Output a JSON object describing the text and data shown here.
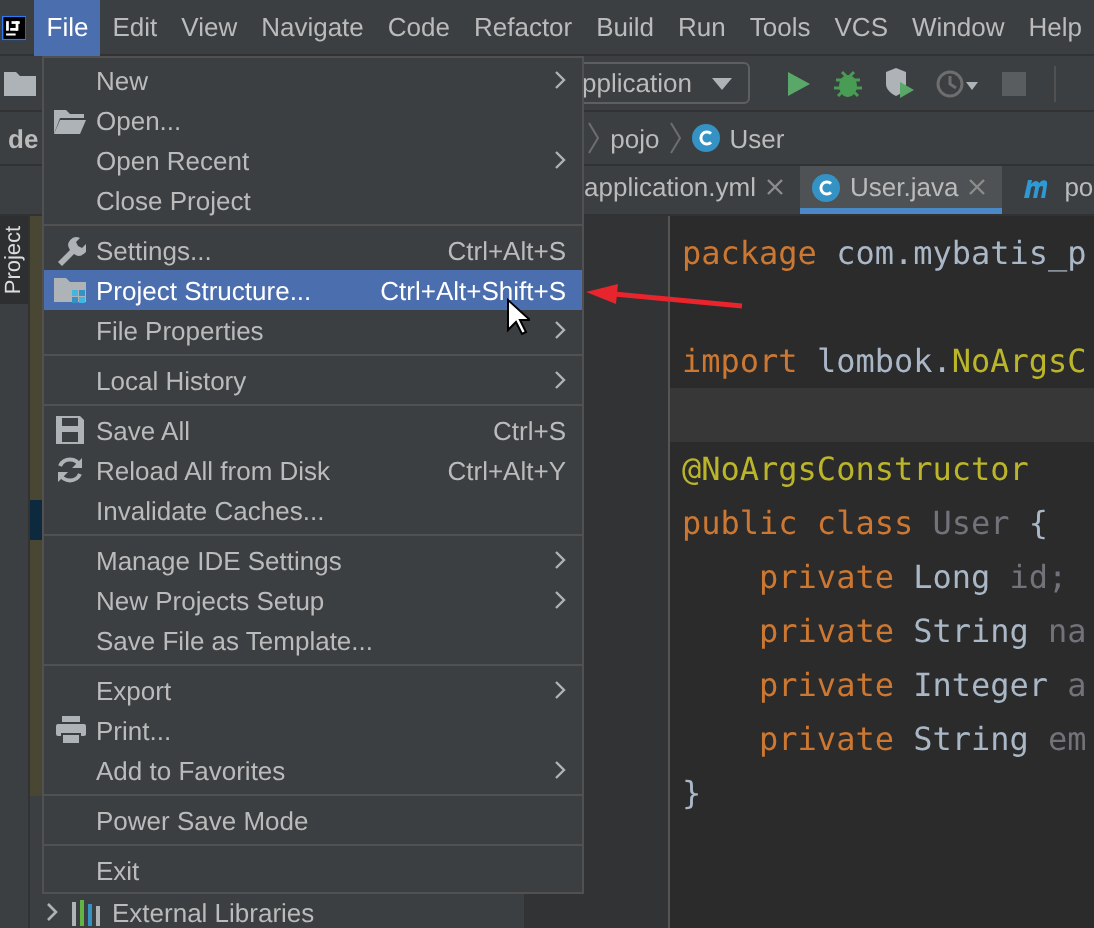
{
  "menubar": [
    {
      "label": "File",
      "selected": true
    },
    {
      "label": "Edit",
      "selected": false
    },
    {
      "label": "View",
      "selected": false
    },
    {
      "label": "Navigate",
      "selected": false
    },
    {
      "label": "Code",
      "selected": false
    },
    {
      "label": "Refactor",
      "selected": false
    },
    {
      "label": "Build",
      "selected": false
    },
    {
      "label": "Run",
      "selected": false
    },
    {
      "label": "Tools",
      "selected": false
    },
    {
      "label": "VCS",
      "selected": false
    },
    {
      "label": "Window",
      "selected": false
    },
    {
      "label": "Help",
      "selected": false
    }
  ],
  "toolbar": {
    "run_config": "pplication"
  },
  "breadcrumbs": [
    {
      "label": "de",
      "kind": "text"
    },
    {
      "label": "pojo",
      "kind": "text"
    },
    {
      "label": "User",
      "kind": "class"
    }
  ],
  "tabs": [
    {
      "label": "application.yml",
      "selected": false,
      "kind": "yaml"
    },
    {
      "label": "User.java",
      "selected": true,
      "kind": "class"
    },
    {
      "label": "po",
      "selected": false,
      "kind": "mapper"
    }
  ],
  "project_tool_tab": {
    "label": "Project",
    "selected": true
  },
  "project_tree": [
    {
      "label": "External Libraries"
    }
  ],
  "code": [
    {
      "current": false,
      "tokens": [
        {
          "kind": "kw",
          "text": "package "
        },
        {
          "kind": "plain",
          "text": "com.mybatis_p"
        }
      ]
    },
    {
      "current": false
    },
    {
      "current": false,
      "tokens": [
        {
          "kind": "kw",
          "text": "import "
        },
        {
          "kind": "plain",
          "text": "lombok."
        },
        {
          "kind": "ann",
          "text": "NoArgsC"
        }
      ]
    },
    {
      "current": true
    },
    {
      "current": false,
      "tokens": [
        {
          "kind": "ann",
          "text": "@NoArgsConstructor"
        }
      ]
    },
    {
      "current": false,
      "tokens": [
        {
          "kind": "kw",
          "text": "public class "
        },
        {
          "kind": "dim",
          "text": "User "
        },
        {
          "kind": "plain",
          "text": "{"
        }
      ]
    },
    {
      "current": false,
      "tokens": [
        {
          "kind": "kw",
          "text": "    private "
        },
        {
          "kind": "plain",
          "text": "Long "
        },
        {
          "kind": "dim",
          "text": "id;"
        }
      ]
    },
    {
      "current": false,
      "tokens": [
        {
          "kind": "kw",
          "text": "    private "
        },
        {
          "kind": "plain",
          "text": "String "
        },
        {
          "kind": "dim",
          "text": "na"
        }
      ]
    },
    {
      "current": false,
      "tokens": [
        {
          "kind": "kw",
          "text": "    private "
        },
        {
          "kind": "plain",
          "text": "Integer "
        },
        {
          "kind": "dim",
          "text": "a"
        }
      ]
    },
    {
      "current": false,
      "tokens": [
        {
          "kind": "kw",
          "text": "    private "
        },
        {
          "kind": "plain",
          "text": "String "
        },
        {
          "kind": "dim",
          "text": "em"
        }
      ]
    },
    {
      "current": false,
      "tokens": [
        {
          "kind": "plain",
          "text": "}"
        }
      ]
    }
  ],
  "file_menu": [
    {
      "kind": "item",
      "label": "New",
      "submenu": true,
      "selected": false
    },
    {
      "kind": "item",
      "label": "Open...",
      "selected": false
    },
    {
      "kind": "item",
      "label": "Open Recent",
      "submenu": true,
      "selected": false
    },
    {
      "kind": "item",
      "label": "Close Project",
      "selected": false
    },
    {
      "kind": "separator"
    },
    {
      "kind": "item",
      "label": "Settings...",
      "shortcut": "Ctrl+Alt+S",
      "selected": false
    },
    {
      "kind": "item",
      "label": "Project Structure...",
      "shortcut": "Ctrl+Alt+Shift+S",
      "selected": true
    },
    {
      "kind": "item",
      "label": "File Properties",
      "submenu": true,
      "selected": false
    },
    {
      "kind": "separator"
    },
    {
      "kind": "item",
      "label": "Local History",
      "submenu": true,
      "selected": false
    },
    {
      "kind": "separator"
    },
    {
      "kind": "item",
      "label": "Save All",
      "shortcut": "Ctrl+S",
      "selected": false
    },
    {
      "kind": "item",
      "label": "Reload All from Disk",
      "shortcut": "Ctrl+Alt+Y",
      "selected": false
    },
    {
      "kind": "item",
      "label": "Invalidate Caches...",
      "selected": false
    },
    {
      "kind": "separator"
    },
    {
      "kind": "item",
      "label": "Manage IDE Settings",
      "submenu": true,
      "selected": false
    },
    {
      "kind": "item",
      "label": "New Projects Setup",
      "submenu": true,
      "selected": false
    },
    {
      "kind": "item",
      "label": "Save File as Template...",
      "selected": false
    },
    {
      "kind": "separator"
    },
    {
      "kind": "item",
      "label": "Export",
      "submenu": true,
      "selected": false
    },
    {
      "kind": "item",
      "label": "Print...",
      "selected": false
    },
    {
      "kind": "item",
      "label": "Add to Favorites",
      "submenu": true,
      "selected": false
    },
    {
      "kind": "separator"
    },
    {
      "kind": "item",
      "label": "Power Save Mode",
      "selected": false
    },
    {
      "kind": "separator"
    },
    {
      "kind": "item",
      "label": "Exit",
      "selected": false
    }
  ]
}
